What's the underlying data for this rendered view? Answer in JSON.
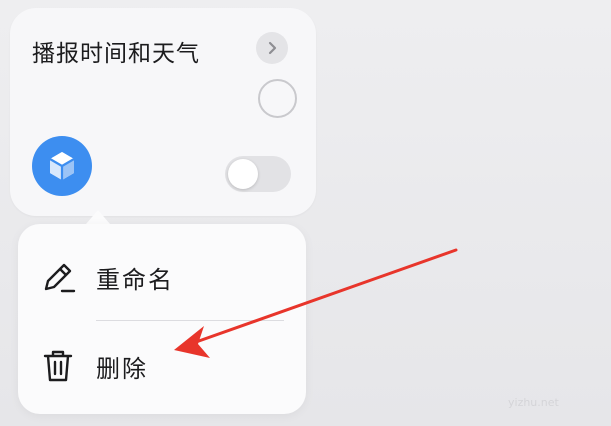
{
  "card": {
    "title": "播报时间和天气",
    "chevron_icon": "chevron-right-icon",
    "app_icon": "shortcuts-cube-icon",
    "app_icon_color": "#3d8ef0",
    "toggle_state": "off"
  },
  "menu": {
    "items": [
      {
        "label": "重命名",
        "icon": "pencil-icon"
      },
      {
        "label": "删除",
        "icon": "trash-icon"
      }
    ]
  },
  "annotation": {
    "arrow_color": "#e8352b",
    "points_to": "删除"
  },
  "watermark": "yizhu.net"
}
